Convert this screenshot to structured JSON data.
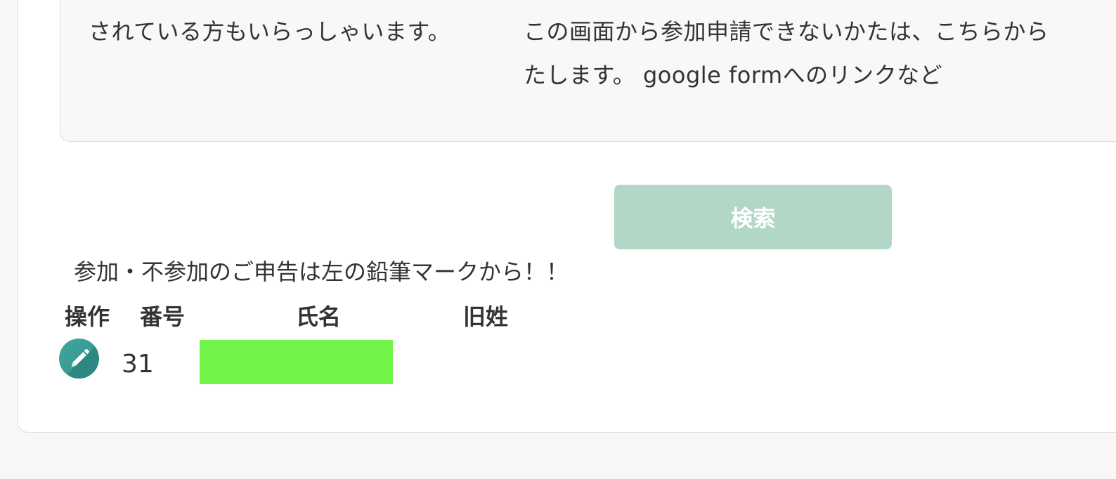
{
  "notice": {
    "left_line1": "されている方もいらっしゃいます。",
    "right_line1": "この画面から参加申請できないかたは、こちらから",
    "right_line2": "たします。 google formへのリンクなど"
  },
  "search": {
    "button_label": "検索"
  },
  "instruction": "参加・不参加のご申告は左の鉛筆マークから！！",
  "table": {
    "headers": [
      "操作",
      "番号",
      "氏名",
      "旧姓"
    ],
    "rows": [
      {
        "number": "31",
        "name": "",
        "maiden_name": ""
      }
    ]
  },
  "colors": {
    "search_button": "#b2d7c7",
    "edit_icon": "#3fa79f",
    "name_redaction": "#72f54a"
  },
  "icons": {
    "edit": "pencil-icon"
  }
}
